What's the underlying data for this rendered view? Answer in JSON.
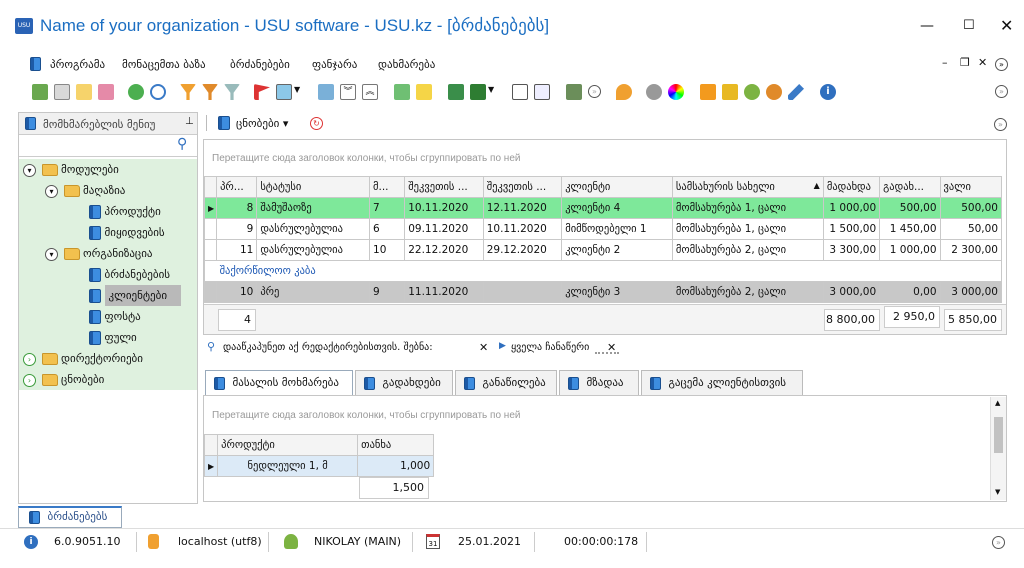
{
  "window": {
    "title": "Name of your organization - USU software - USU.kz - [ბრძანებებს]",
    "logo": "USU"
  },
  "menubar": [
    "პროგრამა",
    "მონაცემთა ბაზა",
    "ბრძანებები",
    "ფანჯარა",
    "დახმარება"
  ],
  "sidebar": {
    "title": "მომხმარებლის მენიუ",
    "items": [
      {
        "label": "მოდულები"
      },
      {
        "label": "მაღაზია"
      },
      {
        "label": "პროდუქტი"
      },
      {
        "label": "მიყიდვების"
      },
      {
        "label": "ორგანიზაცია"
      },
      {
        "label": "ბრძანებების"
      },
      {
        "label": "კლიენტები"
      },
      {
        "label": "ფოსტა"
      },
      {
        "label": "ფული"
      },
      {
        "label": "დირექტორიები"
      },
      {
        "label": "ცნობები"
      }
    ]
  },
  "subtoolbar": {
    "reports_label": "ცნობები"
  },
  "grid": {
    "group_hint": "Перетащите сюда заголовок колонки, чтобы сгруппировать по ней",
    "columns": [
      "პრ...",
      "სტატუსი",
      "მ...",
      "შეკვეთის ...",
      "შეკვეთის ...",
      "კლიენტი",
      "სამსახურის სახელი",
      "მადახდა",
      "გადახ...",
      "ვალი"
    ],
    "rows": [
      [
        "8",
        "შამუშაოზე",
        "7",
        "10.11.2020",
        "12.11.2020",
        "კლიენტი 4",
        "მომსახურება 1, ცალი",
        "1 000,00",
        "500,00",
        "500,00"
      ],
      [
        "9",
        "დასრულებულია",
        "6",
        "09.11.2020",
        "10.11.2020",
        "მიმწოდებელი 1",
        "მომსახურება 1, ცალი",
        "1 500,00",
        "1 450,00",
        "50,00"
      ],
      [
        "11",
        "დასრულებულია",
        "10",
        "22.12.2020",
        "29.12.2020",
        "კლიენტი 2",
        "მომსახურება 2, ცალი",
        "3 300,00",
        "1 000,00",
        "2 300,00"
      ],
      [
        "10",
        "პრე",
        "9",
        "11.11.2020",
        "",
        "კლიენტი 3",
        "მომსახურება 2, ცალი",
        "3 000,00",
        "0,00",
        "3 000,00"
      ]
    ],
    "group_label": "შაქორწილოო კაბა",
    "footer": {
      "count": "4",
      "sum1": "8 800,00",
      "sum2": "2 950,0",
      "sum3": "5 850,00"
    }
  },
  "filter": {
    "text": "დააწკაპუნეთ აქ რედაქტირებისთვის. შებნა:",
    "all_records": "ყველა ჩანაწერი"
  },
  "tabs": [
    "მასალის მოხმარება",
    "გადახდები",
    "განაწილება",
    "მზადაა",
    "გაცემა კლიენტისთვის"
  ],
  "detail": {
    "group_hint": "Перетащите сюда заголовок колонки, чтобы сгруппировать по ней",
    "columns": [
      "პროდუქტი",
      "თანხა"
    ],
    "rows": [
      [
        "ნედლეული 1, მ",
        "1,000"
      ]
    ],
    "total": "1,500"
  },
  "bottom_tab": "ბრძანებებს",
  "status": {
    "version": "6.0.9051.10",
    "db": "localhost (utf8)",
    "user": "NIKOLAY (MAIN)",
    "date": "25.01.2021",
    "timer": "00:00:00:178",
    "cal": "31"
  },
  "colors": {
    "title": "#1b6ec2",
    "selected_row": "#7ee89a",
    "tree_bg": "#e6f4e6",
    "highlight": "#b9b9b9"
  }
}
